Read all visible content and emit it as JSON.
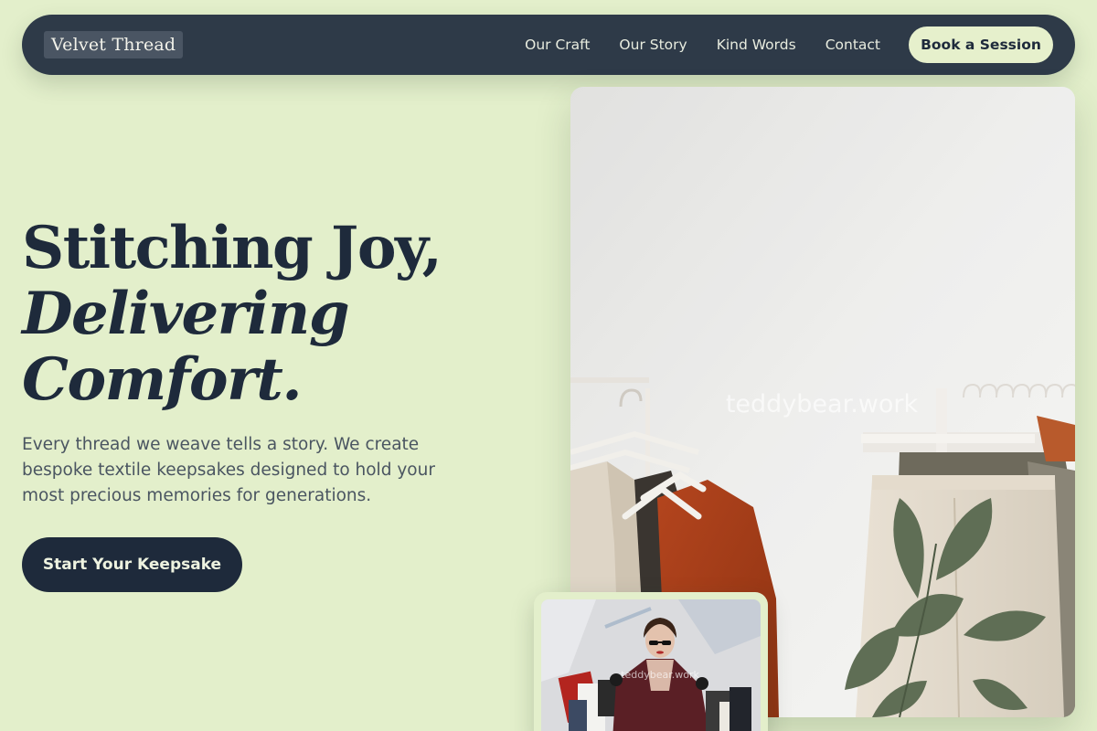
{
  "brand": {
    "name": "Velvet Thread"
  },
  "nav": {
    "links": [
      {
        "label": "Our Craft"
      },
      {
        "label": "Our Story"
      },
      {
        "label": "Kind Words"
      },
      {
        "label": "Contact"
      }
    ],
    "cta": "Book a Session"
  },
  "hero": {
    "headline_line1": "Stitching Joy,",
    "headline_line2": "Delivering",
    "headline_line3": "Comfort.",
    "subtext": "Every thread we weave tells a story. We create bespoke textile keepsakes designed to hold your most precious memories for generations.",
    "cta": "Start Your Keepsake"
  },
  "images": {
    "main_watermark": "teddybear.work",
    "thumb_watermark": "teddybear.work"
  },
  "colors": {
    "background": "#e3efcb",
    "nav_bg": "#2e3a48",
    "ink": "#1e2a3b",
    "accent_light": "#e6f0cc"
  }
}
